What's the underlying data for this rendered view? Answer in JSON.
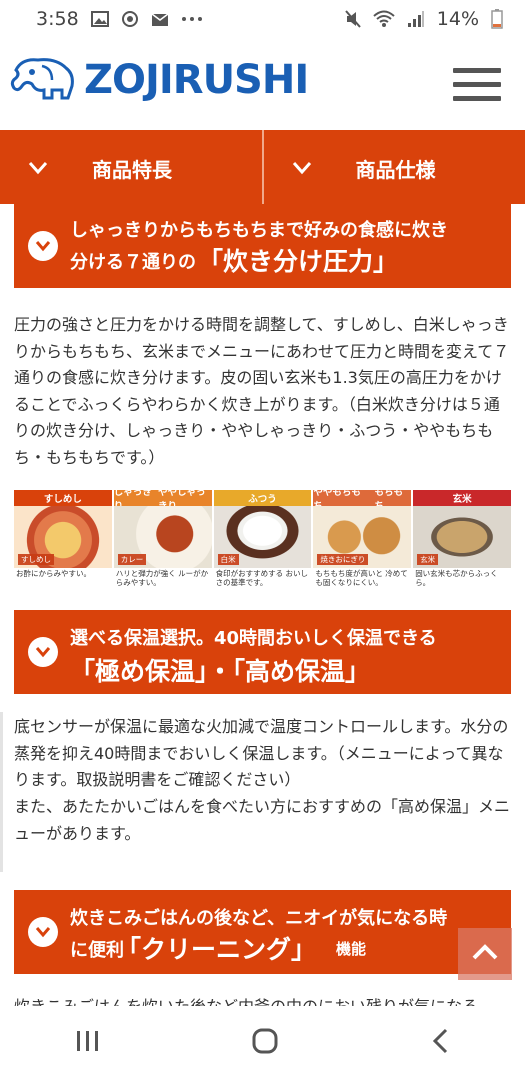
{
  "status_bar": {
    "time": "3:58",
    "battery": "14%",
    "left_icons": [
      "image-icon",
      "sync-icon",
      "mail-icon",
      "more-icon"
    ],
    "right_icons": [
      "mute-icon",
      "wifi-icon",
      "signal-icon",
      "battery-icon"
    ]
  },
  "header": {
    "logo_text": "ZOJIRUSHI",
    "brand_color": "#1a5fb4",
    "menu_icon": "hamburger-icon"
  },
  "tabs": [
    {
      "label": "商品特長",
      "icon": "chevron-down-icon"
    },
    {
      "label": "商品仕様",
      "icon": "chevron-down-icon"
    }
  ],
  "accent_color": "#d9420b",
  "sections": [
    {
      "title_line1": "しゃっきりからもちもちまで好みの食感に炊き",
      "title_line2_small": "分ける７通りの",
      "title_line2_large": "「炊き分け圧力」",
      "body": "圧力の強さと圧力をかける時間を調整して、すしめし、白米しゃっきりからもちもち、玄米までメニューにあわせて圧力と時間を変えて７通りの食感に炊き分けます。皮の固い玄米も1.3気圧の高圧力をかけることでふっくらやわらかく炊き上がります。（白米炊き分けは５通りの炊き分け、しゃっきり・ややしゃっきり・ふつう・ややもちもち・もちもちです。）"
    },
    {
      "title_line1": "選べる保温選択。40時間おいしく保温できる",
      "title_line2_large": "「極め保温」・「高め保温」",
      "body1": "底センサーが保温に最適な火加減で温度コントロールします。水分の蒸発を抑え40時間までおいしく保温します。（メニューによって異なります。取扱説明書をご確認ください）",
      "body2": "また、あたたかいごはんを食べたい方におすすめの「高め保温」メニューがあります。"
    },
    {
      "title_line1": "炊きこみごはんの後など、ニオイが気になる時",
      "title_line2_small": "に便利",
      "title_line2_large": "「クリーニング」",
      "title_line2_suffix": "機能",
      "body_partial": "炊きこみごはんを炊いた後など内釜の中のにおい残りが気になる"
    }
  ],
  "photos": [
    {
      "header": [
        "すしめし"
      ],
      "tag": "すしめし",
      "desc": "お酢にからみやすい。",
      "color": "#d9420b"
    },
    {
      "header": [
        "しゃっきり",
        "ややしゃっきり"
      ],
      "tag": "カレー",
      "desc": "ハリと弾力が強く ルーがからみやすい。",
      "color": "#e8842a"
    },
    {
      "header": [
        "ふつう"
      ],
      "tag": "白米",
      "desc": "食印がおすすめする おいしさの基準です。",
      "color": "#e8a92a"
    },
    {
      "header": [
        "ややもちもち",
        "もちもち"
      ],
      "tag": "焼きおにぎり",
      "desc": "もちもち度が高いと 冷めても固くなりにくい。",
      "color": "#de6a3a"
    },
    {
      "header": [
        "玄米"
      ],
      "tag": "玄米",
      "desc": "固い玄米も芯からふっくら。",
      "color": "#c9282a"
    }
  ],
  "scroll_top_icon": "chevron-up-icon",
  "nav_bar": [
    "recents-icon",
    "home-icon",
    "back-icon"
  ]
}
